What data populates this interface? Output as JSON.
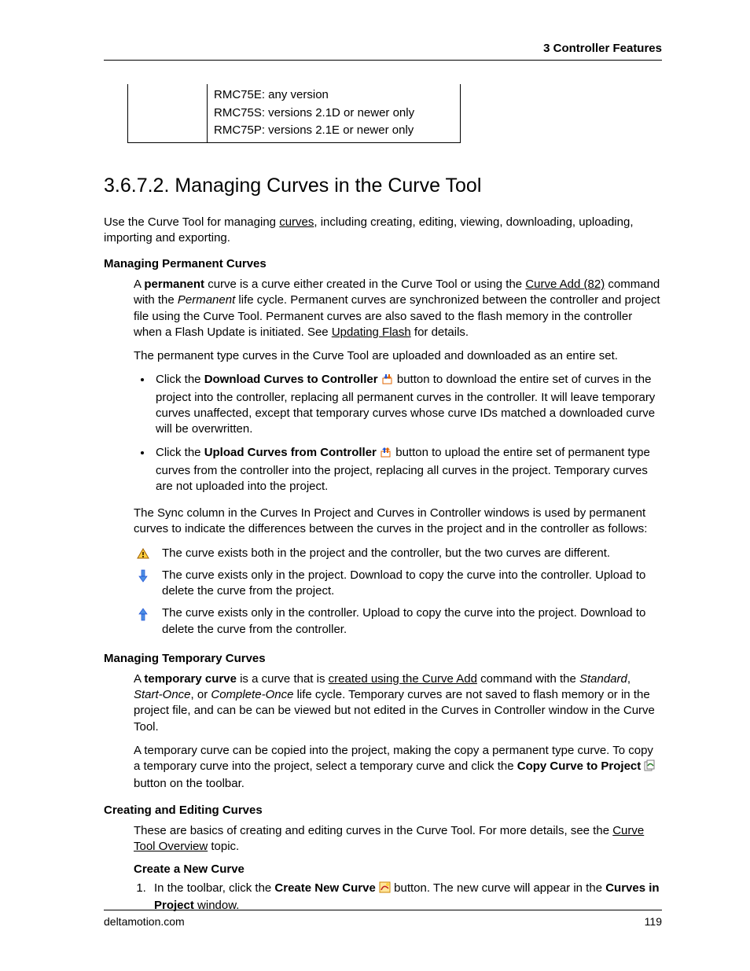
{
  "header": {
    "right": "3  Controller Features"
  },
  "versionTable": {
    "left": "",
    "right": "RMC75E: any version\nRMC75S: versions 2.1D or newer only\nRMC75P: versions 2.1E or newer only"
  },
  "section": {
    "number": "3.6.7.2.",
    "title": "Managing Curves in the Curve Tool",
    "intro_a": "Use the Curve Tool for managing ",
    "intro_link": "curves",
    "intro_b": ", including creating, editing, viewing, downloading, uploading, importing and exporting."
  },
  "perm": {
    "heading": "Managing Permanent Curves",
    "p1_a": "A ",
    "p1_bold1": "permanent",
    "p1_b": " curve is a curve either created in the Curve Tool or using the ",
    "p1_link1": "Curve Add (82)",
    "p1_c": " command with the ",
    "p1_em1": "Permanent",
    "p1_d": " life cycle. Permanent curves are synchronized between the controller and project file using the Curve Tool. Permanent curves are also saved to the flash memory in the controller when a Flash Update is initiated. See ",
    "p1_link2": "Updating Flash",
    "p1_e": " for details.",
    "p2": "The permanent type curves in the Curve Tool are uploaded and downloaded as an entire set.",
    "bullet1_a": "Click the ",
    "bullet1_bold": "Download Curves to Controller",
    "bullet1_b": " button to download the entire set of curves in the project into the controller, replacing all permanent curves in the controller. It will leave temporary curves unaffected, except that temporary curves whose curve IDs matched a downloaded curve will be overwritten.",
    "bullet2_a": "Click the ",
    "bullet2_bold": "Upload Curves from Controller",
    "bullet2_b": " button to upload the entire set of permanent type curves from the controller into the project, replacing all curves in the project. Temporary curves are not uploaded into the project.",
    "sync_intro": "The Sync column in the Curves In Project and Curves in Controller windows is used by permanent curves to indicate the differences between the curves in the project and in the controller as follows:",
    "rows": [
      "The curve exists both in the project and the controller, but the two curves are different.",
      "The curve exists only in the project. Download to copy the curve into the controller. Upload to delete the curve from the project.",
      "The curve exists only in the controller. Upload to copy the curve into the project. Download to delete the curve from the controller."
    ]
  },
  "temp": {
    "heading": "Managing Temporary Curves",
    "p1_a": "A ",
    "p1_bold": "temporary curve",
    "p1_b": " is a curve that is ",
    "p1_link": "created using the Curve Add",
    "p1_c": " command with the ",
    "p1_em1": "Standard",
    "p1_d": ", ",
    "p1_em2": "Start-Once",
    "p1_e": ", or ",
    "p1_em3": "Complete-Once",
    "p1_f": " life cycle. Temporary curves are not saved to flash memory or in the project file, and can be can be viewed but not edited in the Curves in Controller window in the Curve Tool.",
    "p2_a": "A temporary curve can be copied into the project, making the copy a permanent type curve. To copy a temporary curve into the project, select a temporary curve and click the ",
    "p2_bold": "Copy Curve to Project",
    "p2_b": " button on the toolbar."
  },
  "create": {
    "heading": "Creating and Editing Curves",
    "p1_a": "These are basics of creating and editing curves in the Curve Tool. For more details, see the ",
    "p1_link": "Curve Tool Overview",
    "p1_b": " topic.",
    "sub": "Create a New Curve",
    "step1_a": "In the toolbar, click the ",
    "step1_bold1": "Create New Curve",
    "step1_b": " button. The new curve will appear in the ",
    "step1_bold2": "Curves in Project",
    "step1_c": " window."
  },
  "footer": {
    "left": "deltamotion.com",
    "right": "119"
  }
}
